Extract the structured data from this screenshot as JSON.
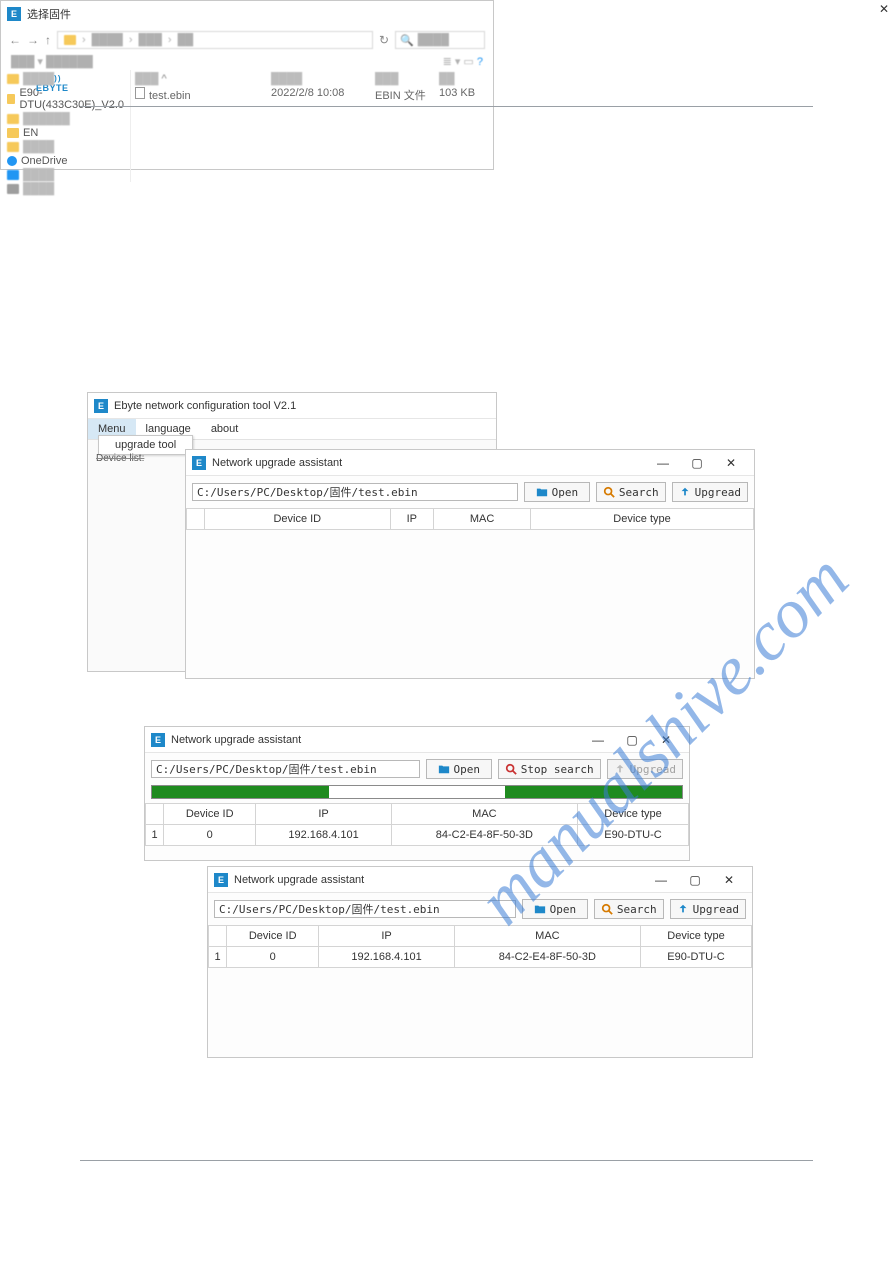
{
  "watermark": "manualshive.com",
  "page_logo": "EBYTE",
  "config_tool": {
    "title": "Ebyte network configuration tool V2.1",
    "menu": {
      "menu": "Menu",
      "language": "language",
      "about": "about"
    },
    "submenu_item": "upgrade tool",
    "panel_label": "Device list:",
    "col_device_id": "Device ID"
  },
  "upgrade_assistant": {
    "title": "Network upgrade assistant",
    "path": "C:/Users/PC/Desktop/固件/test.ebin",
    "buttons": {
      "open": "Open",
      "search": "Search",
      "stop_search": "Stop search",
      "upgread": "Upgread"
    },
    "columns": {
      "device_id": "Device ID",
      "ip": "IP",
      "mac": "MAC",
      "device_type": "Device type"
    },
    "row1": {
      "num": "1",
      "device_id": "0",
      "ip": "192.168.4.101",
      "mac": "84-C2-E4-8F-50-3D",
      "device_type": "E90-DTU-C"
    }
  },
  "file_dialog": {
    "title": "选择固件",
    "refresh_icon": "↻",
    "folders": {
      "e90": "E90-DTU(433C30E)_V2.0",
      "en": "EN",
      "onedrive": "OneDrive"
    },
    "file": {
      "name": "test.ebin",
      "date": "2022/2/8 10:08",
      "type": "EBIN 文件",
      "size": "103 KB"
    }
  }
}
